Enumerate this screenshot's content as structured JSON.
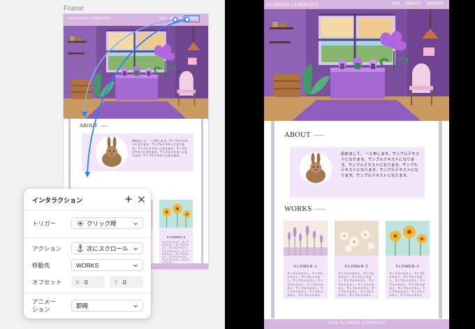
{
  "editor": {
    "frame_label": "Frame"
  },
  "site": {
    "logo": "FLOWER COMPANY",
    "nav": [
      "TOP",
      "ABOUT",
      "WORKS"
    ],
    "about_heading": "ABOUT",
    "about_text": "初めまして。\n一と申します。サンプルテキストになります。サンプルテキストになります。サンプルテキストになります。サンプルテキストになります。サンプルテキストになります。サンプルテキストになります。",
    "works_heading": "WORKS",
    "works": [
      {
        "name": "FLOWER-1",
        "text": "サンプルテキスト、サンプルテキスト、サンプルテキスト、サンプルテキスト、サンプルテキスト、サンプルテキスト、サンプルテキスト、サンプルテキスト、サンプルテキスト、サンプルテキスト"
      },
      {
        "name": "FLOWER-2",
        "text": "サンプルテキスト、サンプルテキスト、サンプルテキスト、サンプルテキスト、サンプルテキスト、サンプルテキスト、サンプルテキスト、サンプルテキスト、サンプルテキスト、サンプルテキスト"
      },
      {
        "name": "FLOWER-3",
        "text": "サンプルテキスト、サンプルテキスト、サンプルテキスト、サンプルテキスト、サンプルテキスト、サンプルテキスト、サンプルテキスト、サンプルテキスト、サンプルテキスト、サンプルテキスト"
      }
    ],
    "footer": "2024 FLOWER COMPANY"
  },
  "interaction_panel": {
    "title": "インタラクション",
    "trigger_label": "トリガー",
    "trigger_value": "クリック時",
    "action_label": "アクション",
    "action_value": "次にスクロール",
    "destination_label": "移動先",
    "destination_value": "WORKS",
    "offset_label": "オフセット",
    "offset_x_axis": "X",
    "offset_x_value": "0",
    "offset_y_axis": "Y",
    "offset_y_value": "0",
    "animation_label": "アニメー\nション",
    "animation_value": "即時"
  },
  "colors": {
    "header_bg": "#d6b6e0",
    "card_bg": "#f3e6fa",
    "accent_line": "#e9a0a8",
    "connector_blue": "#2d7ff9",
    "preview_bg": "#000000"
  },
  "icons": [
    "add-icon",
    "close-icon",
    "tap-icon",
    "anchor-icon",
    "chevron-down-icon"
  ]
}
